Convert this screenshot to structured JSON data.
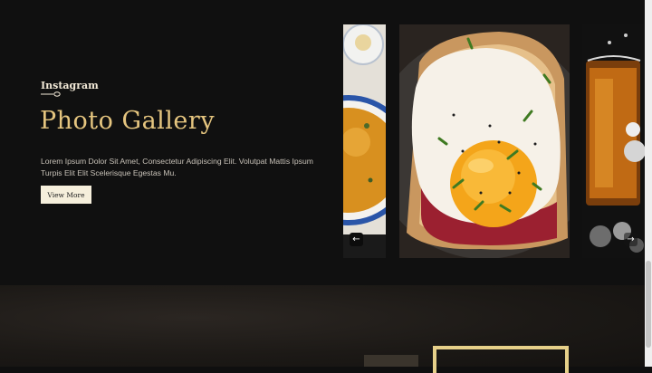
{
  "gallery": {
    "eyebrow": "Instagram",
    "title": "Photo Gallery",
    "description": "Lorem Ipsum Dolor Sit Amet, Consectetur Adipiscing Elit. Volutpat Mattis Ipsum Turpis Elit Elit Scelerisque Egestas Mu.",
    "button_label": "View More"
  },
  "carousel": {
    "prev_icon": "←",
    "next_icon": "→"
  },
  "colors": {
    "background": "#101010",
    "accent_gold": "#e5c57f",
    "button_bg": "#f6efdc",
    "frame_gold": "#e6d089"
  },
  "icons": [
    "arrow-left-icon",
    "arrow-right-icon",
    "spoon-ornament-icon"
  ]
}
